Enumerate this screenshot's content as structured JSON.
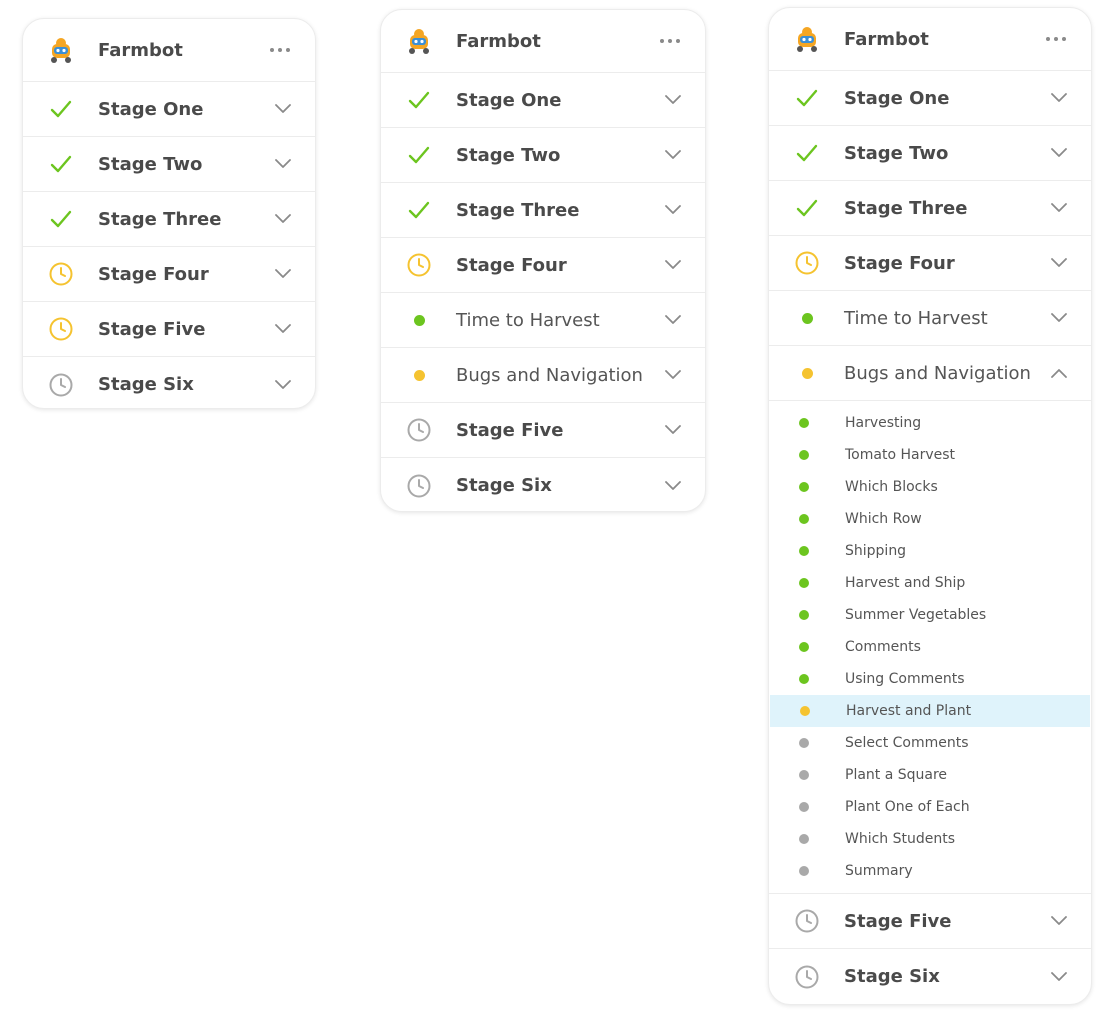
{
  "colors": {
    "complete": "#6cc51f",
    "in_progress": "#f5c330",
    "pending": "#a9a9a9",
    "highlight": "#dff3fb"
  },
  "app": {
    "title": "Farmbot",
    "icon": "farmbot-robot-icon",
    "menu_icon": "more-dots-icon"
  },
  "panel_1": {
    "stages": [
      {
        "label": "Stage One",
        "status": "complete",
        "icon": "check-icon"
      },
      {
        "label": "Stage Two",
        "status": "complete",
        "icon": "check-icon"
      },
      {
        "label": "Stage Three",
        "status": "complete",
        "icon": "check-icon"
      },
      {
        "label": "Stage Four",
        "status": "in_progress",
        "icon": "clock-icon"
      },
      {
        "label": "Stage Five",
        "status": "in_progress",
        "icon": "clock-icon"
      },
      {
        "label": "Stage Six",
        "status": "pending",
        "icon": "clock-icon"
      }
    ]
  },
  "panel_2": {
    "stages": [
      {
        "label": "Stage One",
        "status": "complete",
        "icon": "check-icon"
      },
      {
        "label": "Stage Two",
        "status": "complete",
        "icon": "check-icon"
      },
      {
        "label": "Stage Three",
        "status": "complete",
        "icon": "check-icon"
      },
      {
        "label": "Stage Four",
        "status": "in_progress",
        "icon": "clock-icon"
      },
      {
        "label": "Time to Harvest",
        "status": "complete",
        "icon": "dot-icon",
        "light": true
      },
      {
        "label": "Bugs and Navigation",
        "status": "in_progress",
        "icon": "dot-icon",
        "light": true
      },
      {
        "label": "Stage Five",
        "status": "pending",
        "icon": "clock-icon"
      },
      {
        "label": "Stage Six",
        "status": "pending",
        "icon": "clock-icon"
      }
    ]
  },
  "panel_3": {
    "stages_before": [
      {
        "label": "Stage One",
        "status": "complete",
        "icon": "check-icon"
      },
      {
        "label": "Stage Two",
        "status": "complete",
        "icon": "check-icon"
      },
      {
        "label": "Stage Three",
        "status": "complete",
        "icon": "check-icon"
      },
      {
        "label": "Stage Four",
        "status": "in_progress",
        "icon": "clock-icon"
      },
      {
        "label": "Time to Harvest",
        "status": "complete",
        "icon": "dot-icon",
        "light": true
      }
    ],
    "expanded": {
      "label": "Bugs and Navigation",
      "status": "in_progress",
      "icon": "dot-icon"
    },
    "lessons": [
      {
        "label": "Harvesting",
        "status": "complete"
      },
      {
        "label": "Tomato Harvest",
        "status": "complete"
      },
      {
        "label": "Which Blocks",
        "status": "complete"
      },
      {
        "label": "Which Row",
        "status": "complete"
      },
      {
        "label": "Shipping",
        "status": "complete"
      },
      {
        "label": "Harvest and Ship",
        "status": "complete"
      },
      {
        "label": "Summer Vegetables",
        "status": "complete"
      },
      {
        "label": "Comments",
        "status": "complete"
      },
      {
        "label": "Using Comments",
        "status": "complete"
      },
      {
        "label": "Harvest and Plant",
        "status": "in_progress",
        "selected": true
      },
      {
        "label": "Select Comments",
        "status": "pending"
      },
      {
        "label": "Plant a Square",
        "status": "pending"
      },
      {
        "label": "Plant One of Each",
        "status": "pending"
      },
      {
        "label": "Which Students",
        "status": "pending"
      },
      {
        "label": "Summary",
        "status": "pending"
      }
    ],
    "stages_after": [
      {
        "label": "Stage Five",
        "status": "pending",
        "icon": "clock-icon"
      },
      {
        "label": "Stage Six",
        "status": "pending",
        "icon": "clock-icon"
      }
    ]
  }
}
